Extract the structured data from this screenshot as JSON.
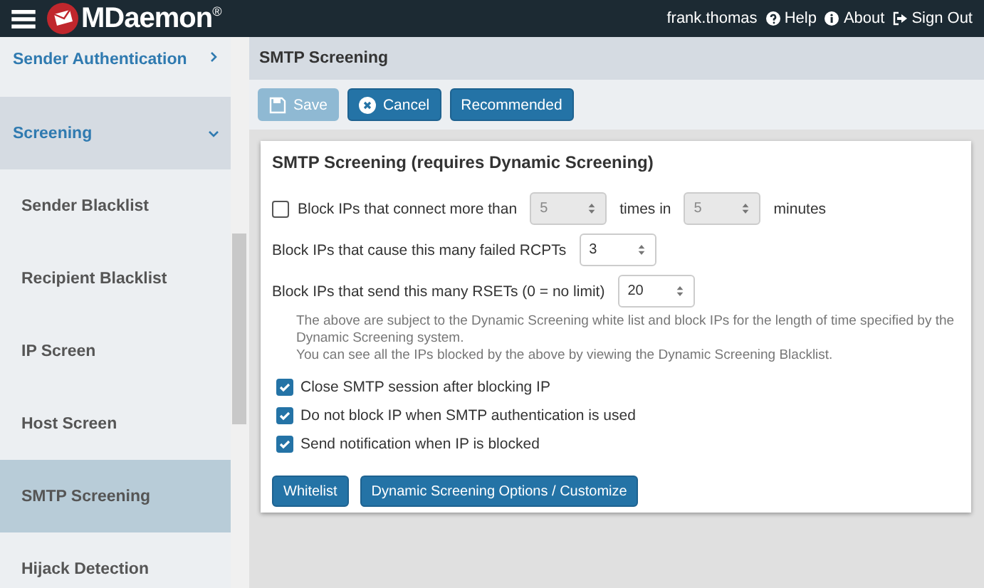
{
  "header": {
    "logo": "MDaemon",
    "logo_mark": "®",
    "user": "frank.thomas",
    "links": [
      {
        "kind": "help",
        "label": "Help"
      },
      {
        "kind": "about",
        "label": "About"
      },
      {
        "kind": "signout",
        "label": "Sign Out"
      }
    ]
  },
  "sidebar": {
    "items": [
      {
        "kind": "group",
        "label": "Sender Authentication",
        "expanded": false,
        "selected": false
      },
      {
        "kind": "group",
        "label": "Screening",
        "expanded": true,
        "selected": false
      },
      {
        "kind": "item",
        "label": "Sender Blacklist",
        "selected": false
      },
      {
        "kind": "item",
        "label": "Recipient Blacklist",
        "selected": false
      },
      {
        "kind": "item",
        "label": "IP Screen",
        "selected": false
      },
      {
        "kind": "item",
        "label": "Host Screen",
        "selected": false
      },
      {
        "kind": "item",
        "label": "SMTP Screening",
        "selected": true
      },
      {
        "kind": "item",
        "label": "Hijack Detection",
        "selected": false
      }
    ]
  },
  "page_title": "SMTP Screening",
  "toolbar": [
    {
      "kind": "save",
      "label": "Save",
      "disabled": true
    },
    {
      "kind": "cancel",
      "label": "Cancel",
      "disabled": false
    },
    {
      "kind": "plain",
      "label": "Recommended",
      "disabled": false
    }
  ],
  "card": {
    "title": "SMTP Screening (requires Dynamic Screening)",
    "rows": [
      {
        "kind": "connect",
        "checked": false,
        "label": "Block IPs that connect more than",
        "value": "5",
        "middle": "times in",
        "value2": "5",
        "suffix": "minutes"
      },
      {
        "kind": "spin",
        "label": "Block IPs that cause this many failed RCPTs",
        "value": "3"
      },
      {
        "kind": "spin",
        "label": "Block IPs that send this many RSETs (0 = no limit)",
        "value": "20"
      }
    ],
    "note": [
      "The above are subject to the Dynamic Screening white list and block IPs for the length of time specified by the Dynamic Screening system.",
      "You can see all the IPs blocked by the above by viewing the Dynamic Screening Blacklist."
    ],
    "checks": [
      {
        "label": "Close SMTP session after blocking IP",
        "checked": true
      },
      {
        "label": "Do not block IP when SMTP authentication is used",
        "checked": true
      },
      {
        "label": "Send notification when IP is blocked",
        "checked": true
      }
    ],
    "buttons": [
      "Whitelist",
      "Dynamic Screening Options / Customize"
    ]
  }
}
